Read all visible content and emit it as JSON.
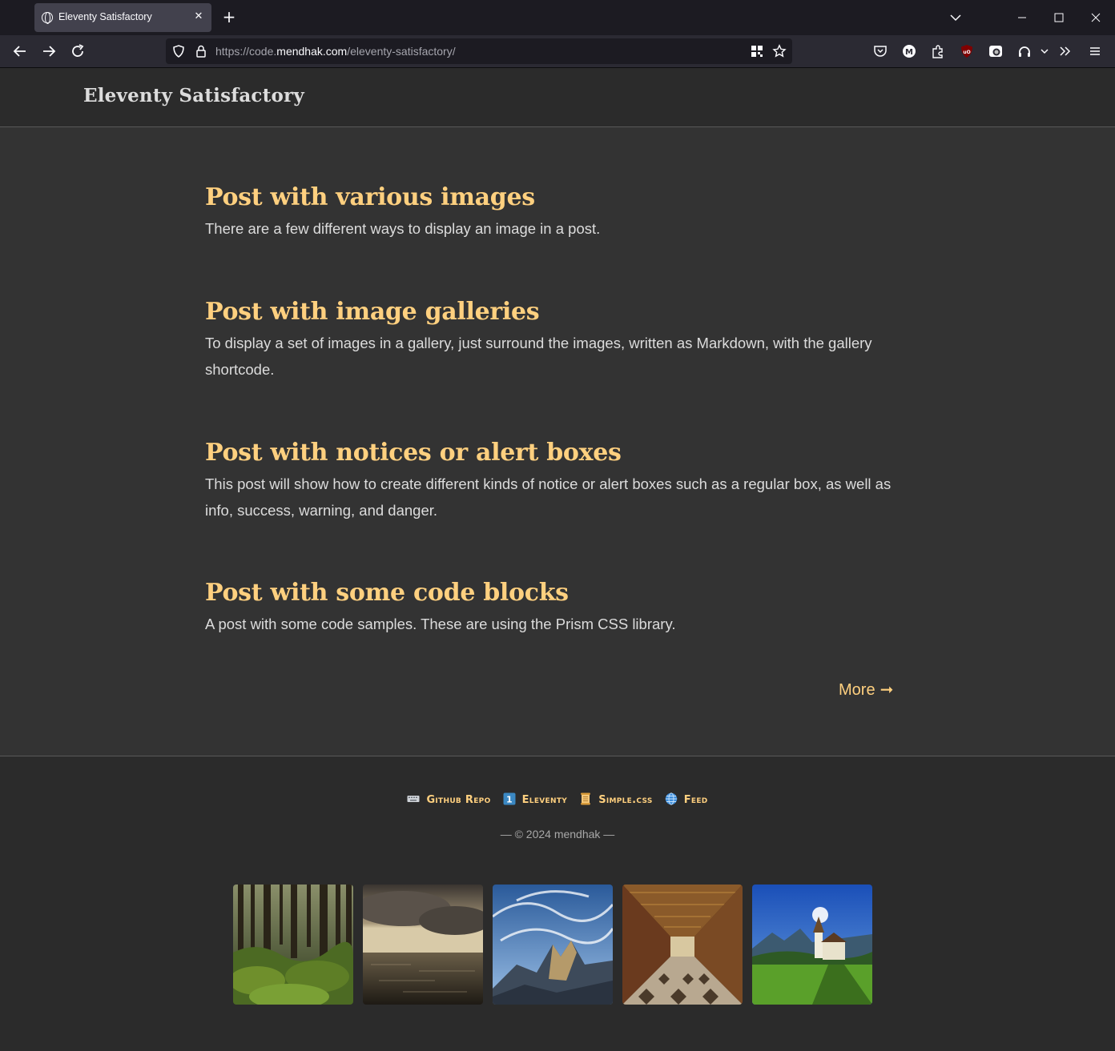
{
  "browser": {
    "tab_title": "Eleventy Satisfactory",
    "url_prefix": "https://code.",
    "url_host": "mendhak.com",
    "url_path": "/eleventy-satisfactory/"
  },
  "site": {
    "title": "Eleventy Satisfactory"
  },
  "posts": [
    {
      "title": "Post with various images",
      "excerpt": "There are a few different ways to display an image in a post."
    },
    {
      "title": "Post with image galleries",
      "excerpt": "To display a set of images in a gallery, just surround the images, written as Markdown, with the gallery shortcode."
    },
    {
      "title": "Post with notices or alert boxes",
      "excerpt": "This post will show how to create different kinds of notice or alert boxes such as a regular box, as well as info, success, warning, and danger."
    },
    {
      "title": "Post with some code blocks",
      "excerpt": "A post with some code samples. These are using the Prism CSS library."
    }
  ],
  "more_label": "More",
  "more_arrow": "➞",
  "footer": {
    "links": [
      {
        "label": "Github Repo",
        "icon": "keyboard-icon"
      },
      {
        "label": "Eleventy",
        "icon": "keycap-one-icon"
      },
      {
        "label": "Simple.css",
        "icon": "scroll-icon"
      },
      {
        "label": "Feed",
        "icon": "globe-icon"
      }
    ],
    "copyright": "— © 2024 mendhak —"
  },
  "gallery": [
    {
      "subject": "mossy forest",
      "icon": "forest-photo"
    },
    {
      "subject": "cloudy sea",
      "icon": "sea-photo"
    },
    {
      "subject": "mountain peaks",
      "icon": "mountain-photo"
    },
    {
      "subject": "ornate hall",
      "icon": "hall-photo"
    },
    {
      "subject": "church in meadow",
      "icon": "church-photo"
    }
  ],
  "colors": {
    "accent": "#ffd07f",
    "text": "#dcdcdc",
    "page_bg": "#333333",
    "header_bg": "#2b2b2b"
  }
}
